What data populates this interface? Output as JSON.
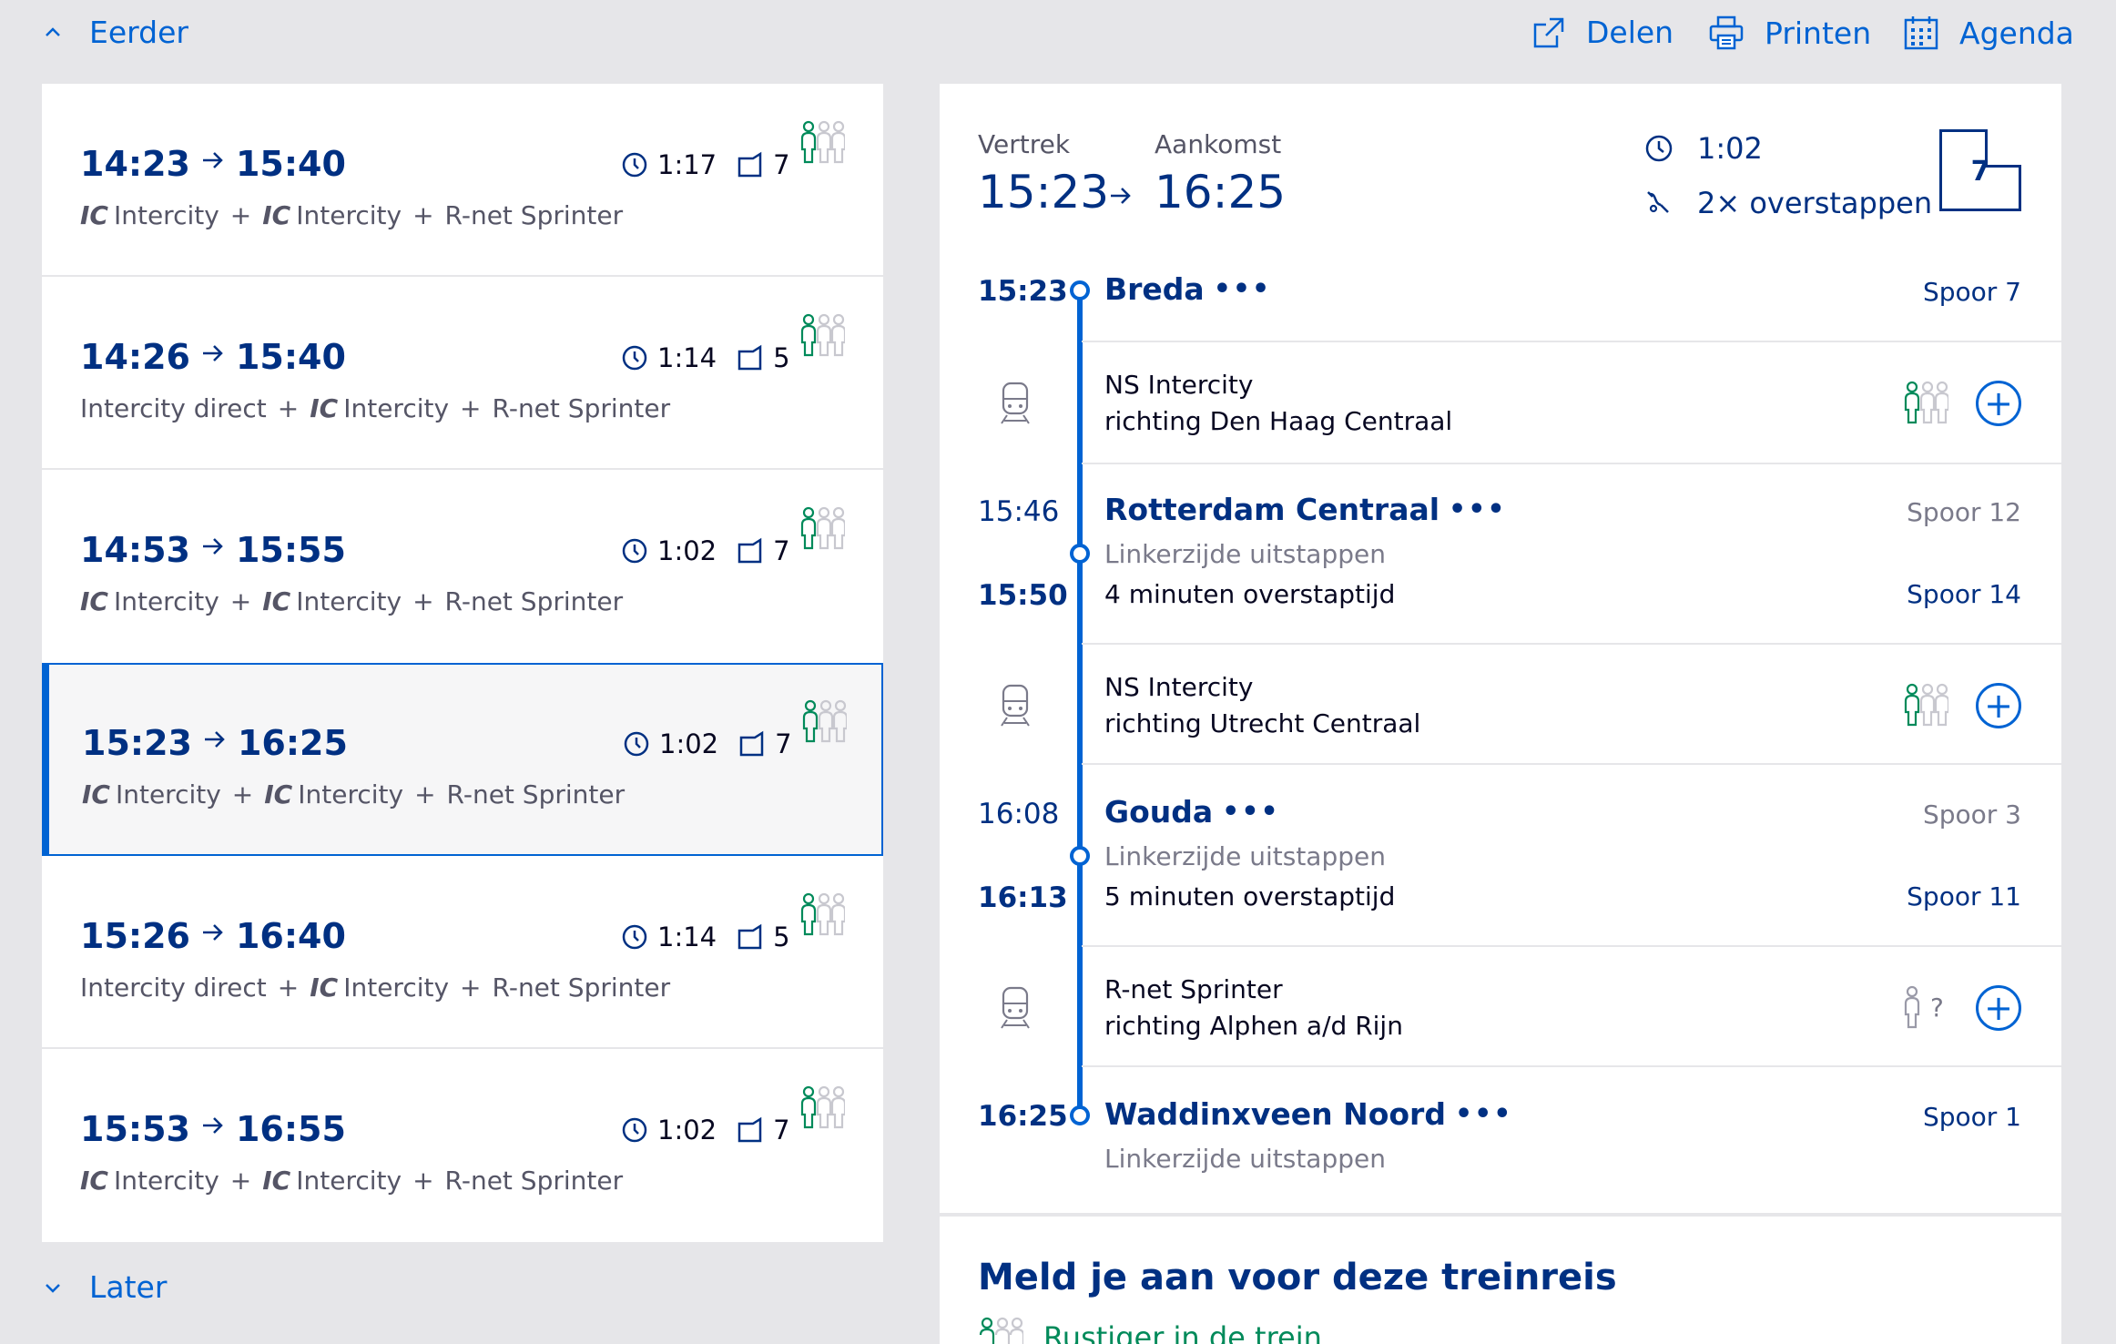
{
  "nav": {
    "earlier_label": "Eerder",
    "later_label": "Later",
    "share_label": "Delen",
    "print_label": "Printen",
    "calendar_label": "Agenda"
  },
  "trips": [
    {
      "dep": "14:23",
      "arr": "15:40",
      "duration": "1:17",
      "platform": "7",
      "legs": [
        "IC|Intercity",
        "IC|Intercity",
        "|R-net Sprinter"
      ],
      "crowd": 1,
      "selected": false
    },
    {
      "dep": "14:26",
      "arr": "15:40",
      "duration": "1:14",
      "platform": "5",
      "legs": [
        "|Intercity direct",
        "IC|Intercity",
        "|R-net Sprinter"
      ],
      "crowd": 1,
      "selected": false
    },
    {
      "dep": "14:53",
      "arr": "15:55",
      "duration": "1:02",
      "platform": "7",
      "legs": [
        "IC|Intercity",
        "IC|Intercity",
        "|R-net Sprinter"
      ],
      "crowd": 1,
      "selected": false
    },
    {
      "dep": "15:23",
      "arr": "16:25",
      "duration": "1:02",
      "platform": "7",
      "legs": [
        "IC|Intercity",
        "IC|Intercity",
        "|R-net Sprinter"
      ],
      "crowd": 1,
      "selected": true
    },
    {
      "dep": "15:26",
      "arr": "16:40",
      "duration": "1:14",
      "platform": "5",
      "legs": [
        "|Intercity direct",
        "IC|Intercity",
        "|R-net Sprinter"
      ],
      "crowd": 1,
      "selected": false
    },
    {
      "dep": "15:53",
      "arr": "16:55",
      "duration": "1:02",
      "platform": "7",
      "legs": [
        "IC|Intercity",
        "IC|Intercity",
        "|R-net Sprinter"
      ],
      "crowd": 1,
      "selected": false
    }
  ],
  "detail": {
    "departure_label": "Vertrek",
    "arrival_label": "Aankomst",
    "departure_time": "15:23",
    "arrival_time": "16:25",
    "duration": "1:02",
    "transfers": "2× overstappen",
    "platform": "7",
    "stops": {
      "breda": {
        "time": "15:23",
        "name": "Breda",
        "spoor": "Spoor 7"
      },
      "leg1": {
        "train": "NS Intercity",
        "direction": "richting Den Haag Centraal"
      },
      "rotterdam": {
        "arr_time": "15:46",
        "name": "Rotterdam Centraal",
        "arr_spoor": "Spoor 12",
        "exit_side": "Linkerzijde uitstappen",
        "dep_time": "15:50",
        "transfer_time": "4 minuten overstaptijd",
        "dep_spoor": "Spoor 14"
      },
      "leg2": {
        "train": "NS Intercity",
        "direction": "richting Utrecht Centraal"
      },
      "gouda": {
        "arr_time": "16:08",
        "name": "Gouda",
        "arr_spoor": "Spoor 3",
        "exit_side": "Linkerzijde uitstappen",
        "dep_time": "16:13",
        "transfer_time": "5 minuten overstaptijd",
        "dep_spoor": "Spoor 11"
      },
      "leg3": {
        "train": "R-net Sprinter",
        "direction": "richting Alphen a/d Rijn",
        "crowd_unknown": "?"
      },
      "waddinxveen": {
        "time": "16:25",
        "name": "Waddinxveen Noord",
        "spoor": "Spoor 1",
        "exit_side": "Linkerzijde uitstappen"
      }
    },
    "more_dots": "•••"
  },
  "signup": {
    "title": "Meld je aan voor deze treinreis",
    "quieter": "Rustiger in de trein"
  },
  "colors": {
    "brand_blue": "#003082",
    "link_blue": "#0063d3",
    "green": "#008a5a",
    "background": "#e6e6e9"
  },
  "icons": [
    "chevron-up-icon",
    "chevron-down-icon",
    "share-icon",
    "print-icon",
    "calendar-icon",
    "clock-icon",
    "platform-icon",
    "crowd-icon",
    "transfer-icon",
    "train-icon",
    "plus-icon"
  ]
}
